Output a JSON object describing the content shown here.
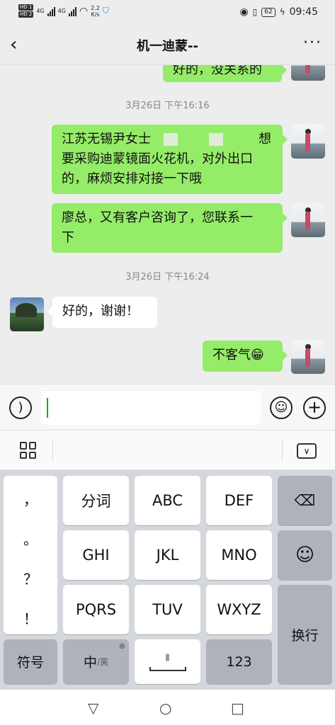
{
  "status_bar": {
    "sim1": "HD 1",
    "sim2": "HD 2",
    "net1": "4G",
    "net2": "4G",
    "speed_value": "2.2",
    "speed_unit": "K/s",
    "battery": "62",
    "time": "09:45"
  },
  "header": {
    "title": "机一迪蒙--",
    "back_icon": "chevron-left-icon",
    "more_label": "···"
  },
  "messages": [
    {
      "type": "sent",
      "text": "好的，没关系的",
      "partial": true
    },
    {
      "type": "time",
      "text": "3月26日 下午16:16"
    },
    {
      "type": "sent",
      "line1": "江苏无锡尹女士",
      "line1_end": "想",
      "line2": "要采购迪蒙镜面火花机，对外出口",
      "line3": "的，麻烦安排对接一下哦"
    },
    {
      "type": "sent",
      "line1": "廖总，又有客户咨询了，您联系一",
      "line2": "下"
    },
    {
      "type": "time",
      "text": "3月26日 下午16:24"
    },
    {
      "type": "received",
      "text": "好的，谢谢！"
    },
    {
      "type": "sent",
      "text": "不客气😁"
    }
  ],
  "input_bar": {
    "voice_icon": "voice-icon",
    "emoji_icon": "emoji-icon",
    "plus_icon": "plus-icon"
  },
  "keyboard": {
    "toolbar": {
      "menu_icon": "grid-icon",
      "collapse_icon": "keyboard-collapse-icon"
    },
    "punct": [
      "，",
      "。",
      "？",
      "！"
    ],
    "rows": [
      [
        "分词",
        "ABC",
        "DEF"
      ],
      [
        "GHI",
        "JKL",
        "MNO"
      ],
      [
        "PQRS",
        "TUV",
        "WXYZ"
      ]
    ],
    "backspace_icon": "backspace-icon",
    "emoji_key_icon": "emoji-icon",
    "enter": "换行",
    "symbols": "符号",
    "lang_main": "中",
    "lang_alt": "/英",
    "space_icon": "microphone-icon",
    "numbers": "123"
  },
  "nav": {
    "back": "▽",
    "home": "○",
    "recents": "□"
  }
}
